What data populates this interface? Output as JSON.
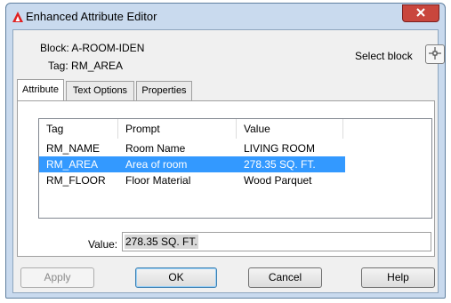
{
  "window": {
    "title": "Enhanced Attribute Editor"
  },
  "header": {
    "block_label": "Block:",
    "block_value": "A-ROOM-IDEN",
    "tag_label": "Tag:",
    "tag_value": "RM_AREA",
    "select_block_label": "Select block"
  },
  "tabs": [
    {
      "label": "Attribute",
      "active": true
    },
    {
      "label": "Text Options",
      "active": false
    },
    {
      "label": "Properties",
      "active": false
    }
  ],
  "list": {
    "columns": [
      "Tag",
      "Prompt",
      "Value"
    ],
    "rows": [
      {
        "tag": "RM_NAME",
        "prompt": "Room Name",
        "value": "LIVING ROOM",
        "selected": false
      },
      {
        "tag": "RM_AREA",
        "prompt": "Area of room",
        "value": "278.35 SQ. FT.",
        "selected": true
      },
      {
        "tag": "RM_FLOOR",
        "prompt": "Floor Material",
        "value": "Wood Parquet",
        "selected": false
      }
    ]
  },
  "value_field": {
    "label": "Value:",
    "value": "278.35 SQ. FT."
  },
  "buttons": {
    "apply": "Apply",
    "ok": "OK",
    "cancel": "Cancel",
    "help": "Help"
  },
  "colors": {
    "selection": "#3399ff",
    "title_bar": "#c9daee",
    "close_button": "#c9463d"
  },
  "icons": {
    "app": "autocad-logo-icon",
    "close": "close-icon",
    "select": "pick-crosshair-icon"
  }
}
